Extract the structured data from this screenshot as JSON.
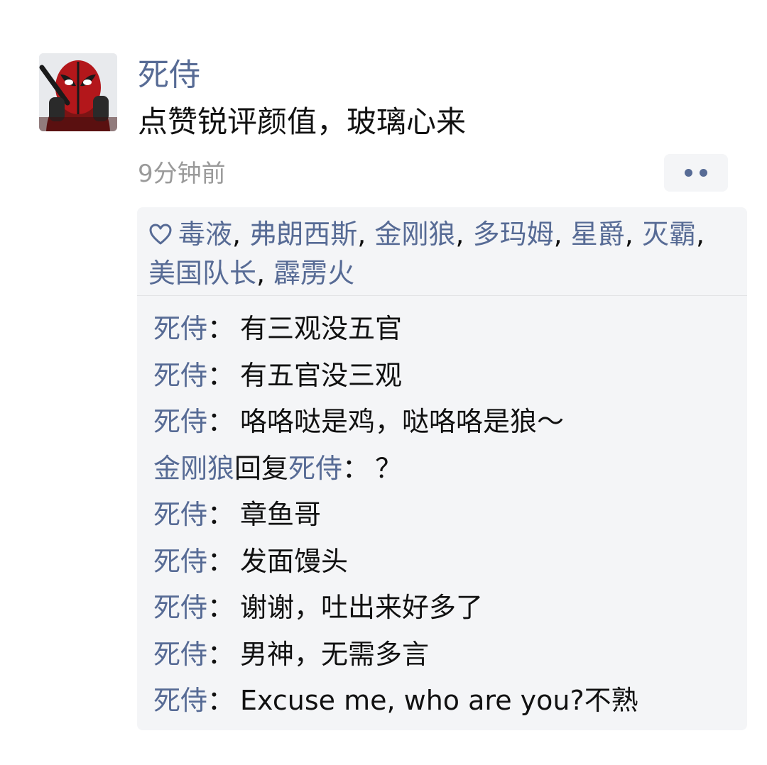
{
  "post": {
    "author": "死侍",
    "text": "点赞锐评颜值，玻璃心来",
    "timestamp": "9分钟前",
    "avatar_icon": "deadpool-avatar"
  },
  "likes": {
    "icon": "heart-icon",
    "names": [
      "毒液",
      "弗朗西斯",
      "金刚狼",
      "多玛姆",
      "星爵",
      "灭霸",
      "美国队长",
      "霹雳火"
    ],
    "separator": ", "
  },
  "comments": [
    {
      "name": "死侍",
      "colon": "：",
      "text": "有三观没五官"
    },
    {
      "name": "死侍",
      "colon": "：",
      "text": "有五官没三观"
    },
    {
      "name": "死侍",
      "colon": "：",
      "text": "咯咯哒是鸡，哒咯咯是狼～"
    },
    {
      "name": "金刚狼",
      "reply_word": "回复",
      "reply_to": "死侍",
      "colon": "：",
      "text": "？"
    },
    {
      "name": "死侍",
      "colon": "：",
      "text": "章鱼哥"
    },
    {
      "name": "死侍",
      "colon": "：",
      "text": "发面馒头"
    },
    {
      "name": "死侍",
      "colon": "：",
      "text": "谢谢，吐出来好多了"
    },
    {
      "name": "死侍",
      "colon": "：",
      "text": "男神，无需多言"
    },
    {
      "name": "死侍",
      "colon": "：",
      "text": "Excuse me, who are you?不熟"
    }
  ],
  "colors": {
    "link": "#576b95",
    "text": "#111111",
    "muted": "#9a9a9a",
    "panel": "#f4f5f7"
  }
}
